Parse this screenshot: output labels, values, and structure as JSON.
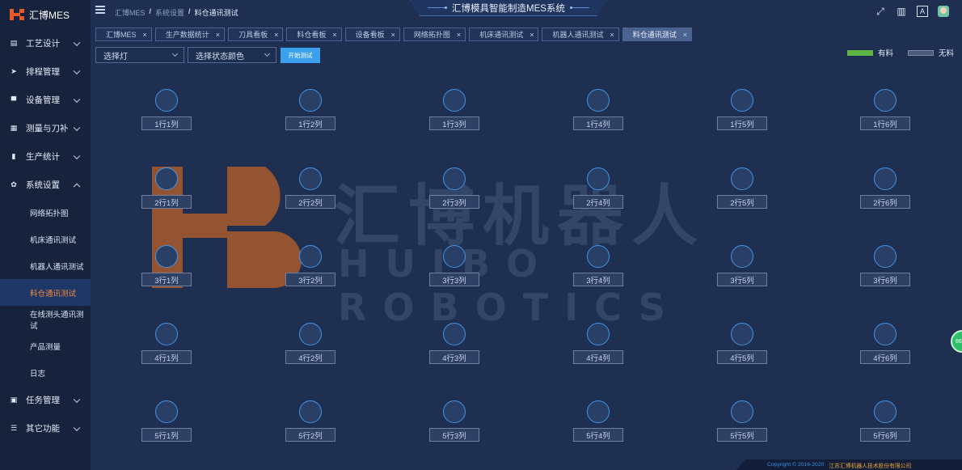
{
  "app": {
    "logo_text": "汇博MES"
  },
  "header": {
    "system_title": "汇博模具智能制造MES系统",
    "breadcrumb": [
      "汇博MES",
      "系统设置",
      "料仓通讯测试"
    ]
  },
  "sidebar": {
    "items": [
      {
        "label": "工艺设计",
        "icon": "document-icon",
        "expanded": false
      },
      {
        "label": "排程管理",
        "icon": "send-icon",
        "expanded": false
      },
      {
        "label": "设备管理",
        "icon": "monitor-icon",
        "expanded": false
      },
      {
        "label": "测量与刀补",
        "icon": "table-icon",
        "expanded": false
      },
      {
        "label": "生产统计",
        "icon": "bar-chart-icon",
        "expanded": false
      },
      {
        "label": "系统设置",
        "icon": "gear-icon",
        "expanded": true
      }
    ],
    "sub_items": [
      "网络拓扑图",
      "机床通讯测试",
      "机器人通讯测试",
      "料仓通讯测试",
      "在线测头通讯测试",
      "产品测量",
      "日志"
    ],
    "active_sub": "料仓通讯测试",
    "items_after": [
      {
        "label": "任务管理",
        "icon": "task-icon",
        "expanded": false
      },
      {
        "label": "其它功能",
        "icon": "list-icon",
        "expanded": false
      }
    ]
  },
  "tabs": [
    {
      "label": "汇博MES",
      "active": false
    },
    {
      "label": "生产数据统计",
      "active": false
    },
    {
      "label": "刀具看板",
      "active": false
    },
    {
      "label": "料仓看板",
      "active": false
    },
    {
      "label": "设备看板",
      "active": false
    },
    {
      "label": "网络拓扑图",
      "active": false
    },
    {
      "label": "机床通讯测试",
      "active": false
    },
    {
      "label": "机器人通讯测试",
      "active": false
    },
    {
      "label": "料仓通讯测试",
      "active": true
    }
  ],
  "toolbar": {
    "select_light_placeholder": "选择灯",
    "select_color_placeholder": "选择状态颜色",
    "start_button": "开始测试"
  },
  "legend": {
    "have": "有料",
    "none": "无料",
    "have_color": "#5fb446",
    "none_color": "#4a5a78"
  },
  "grid": {
    "rows": [
      [
        "1行1列",
        "1行2列",
        "1行3列",
        "1行4列",
        "1行5列",
        "1行6列"
      ],
      [
        "2行1列",
        "2行2列",
        "2行3列",
        "2行4列",
        "2行5列",
        "2行6列"
      ],
      [
        "3行1列",
        "3行2列",
        "3行3列",
        "3行4列",
        "3行5列",
        "3行6列"
      ],
      [
        "4行1列",
        "4行2列",
        "4行3列",
        "4行4列",
        "4行5列",
        "4行6列"
      ],
      [
        "5行1列",
        "5行2列",
        "5行3列",
        "5行4列",
        "5行5列",
        "5行6列"
      ]
    ]
  },
  "watermark": {
    "title": "汇博机器人",
    "subtitle": "HUIBO ROBOTICS"
  },
  "footer": {
    "copyright": "Copyright © 2016-2020",
    "company": "江苏汇博机器人技术股份有限公司"
  },
  "side_bubble": "66"
}
